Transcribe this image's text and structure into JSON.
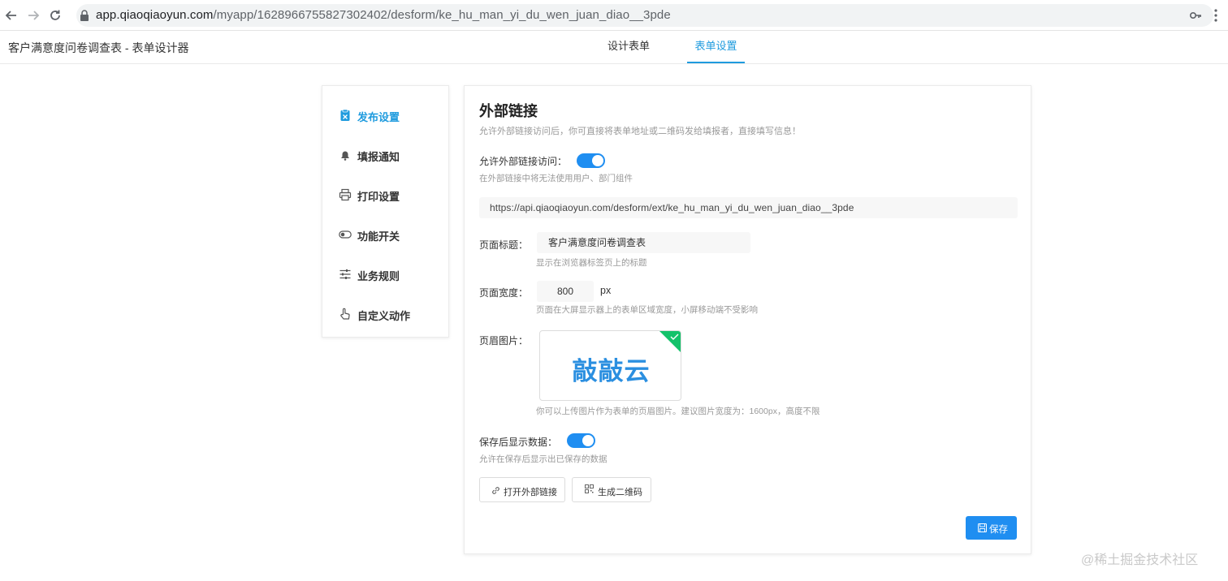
{
  "browser": {
    "url_host": "app.qiaoqiaoyun.com",
    "url_path": "/myapp/1628966755827302402/desform/ke_hu_man_yi_du_wen_juan_diao__3pde",
    "back_icon": "arrow-left-icon",
    "forward_icon": "arrow-right-icon",
    "reload_icon": "reload-icon"
  },
  "header": {
    "title": "客户满意度问卷调查表 - 表单设计器",
    "tabs": [
      {
        "label": "设计表单",
        "active": false
      },
      {
        "label": "表单设置",
        "active": true
      }
    ],
    "accent_color": "#1f9bde"
  },
  "sidebar": {
    "items": [
      {
        "label": "发布设置",
        "icon": "clipboard-icon",
        "active": true
      },
      {
        "label": "填报通知",
        "icon": "bell-icon",
        "active": false
      },
      {
        "label": "打印设置",
        "icon": "printer-icon",
        "active": false
      },
      {
        "label": "功能开关",
        "icon": "toggle-icon",
        "active": false
      },
      {
        "label": "业务规则",
        "icon": "sliders-icon",
        "active": false
      },
      {
        "label": "自定义动作",
        "icon": "hand-pointer-icon",
        "active": false
      }
    ]
  },
  "main": {
    "title": "外部链接",
    "description": "允许外部链接访问后，你可直接将表单地址或二维码发给填报者，直接填写信息！",
    "allow_external": {
      "label": "允许外部链接访问：",
      "enabled": true,
      "hint": "在外部链接中将无法使用用户、部门组件"
    },
    "external_link": "https://api.qiaoqiaoyun.com/desform/ext/ke_hu_man_yi_du_wen_juan_diao__3pde",
    "page_title": {
      "label": "页面标题：",
      "value": "客户满意度问卷调查表",
      "hint": "显示在浏览器标签页上的标题"
    },
    "page_width": {
      "label": "页面宽度：",
      "value": "800",
      "unit": "px",
      "hint": "页面在大屏显示器上的表单区域宽度，小屏移动端不受影响"
    },
    "header_image": {
      "label": "页眉图片：",
      "logo_text": "敲敲云",
      "hint": "你可以上传图片作为表单的页眉图片。建议图片宽度为：1600px，高度不限"
    },
    "show_after_save": {
      "label": "保存后显示数据：",
      "enabled": true,
      "hint": "允许在保存后显示出已保存的数据"
    },
    "buttons": {
      "open_link": "打开外部链接",
      "qrcode": "生成二维码",
      "save": "保存"
    }
  },
  "watermark": "@稀土掘金技术社区"
}
